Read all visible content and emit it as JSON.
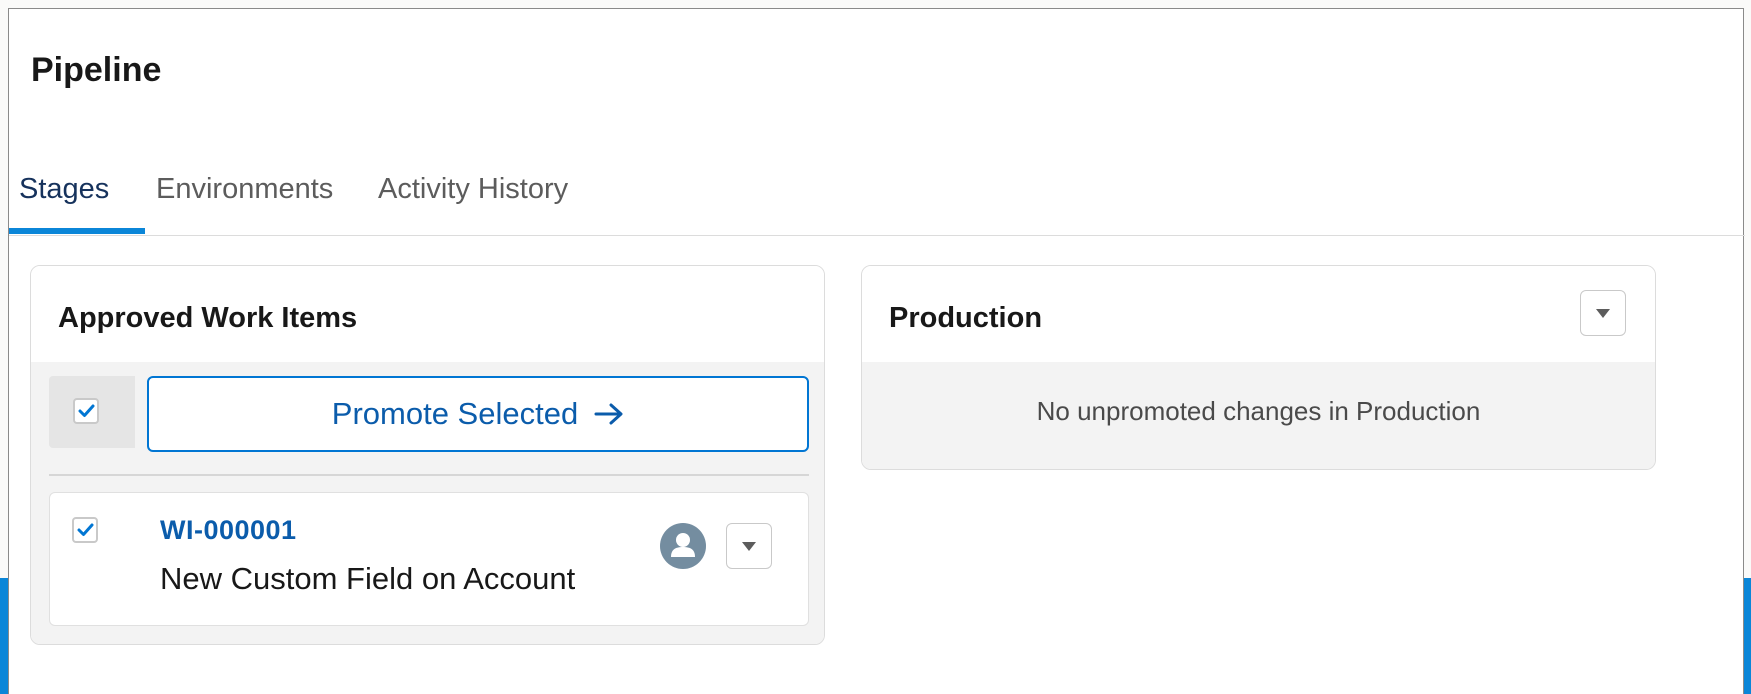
{
  "page": {
    "title": "Pipeline"
  },
  "tabs": [
    {
      "label": "Stages",
      "active": true
    },
    {
      "label": "Environments",
      "active": false
    },
    {
      "label": "Activity History",
      "active": false
    }
  ],
  "approved": {
    "title": "Approved Work Items",
    "select_all_checked": true,
    "promote_label": "Promote Selected",
    "promote_icon": "arrow-right-icon",
    "items": [
      {
        "id": "WI-000001",
        "description": "New Custom Field on Account",
        "checked": true,
        "owner_icon": "user-avatar-icon",
        "menu_icon": "chevron-down-icon"
      }
    ]
  },
  "production": {
    "title": "Production",
    "menu_icon": "chevron-down-icon",
    "empty_message": "No unpromoted changes in Production"
  },
  "colors": {
    "accent": "#0b86d8",
    "link": "#0b5cab",
    "active_tab_text": "#16325c",
    "avatar": "#748da0"
  }
}
